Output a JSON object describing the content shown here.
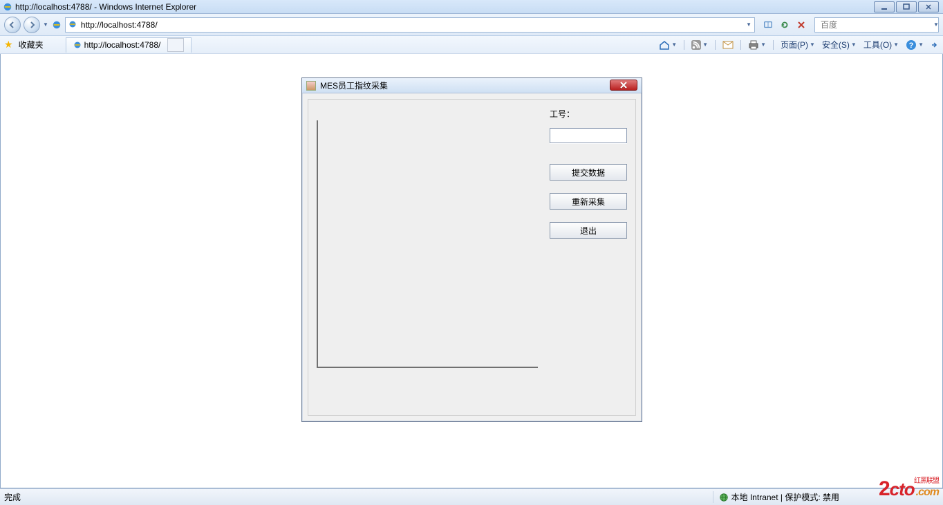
{
  "window_title": "http://localhost:4788/ - Windows Internet Explorer",
  "address_url": "http://localhost:4788/",
  "search_placeholder": "百度",
  "favorites_label": "收藏夹",
  "tab_title": "http://localhost:4788/",
  "cmdbar": {
    "page": "页面(P)",
    "safety": "安全(S)",
    "tools": "工具(O)"
  },
  "dialog": {
    "title": "MES员工指纹采集",
    "worker_id_label": "工号：",
    "worker_id_value": "",
    "submit": "提交数据",
    "recollect": "重新采集",
    "exit": "退出"
  },
  "status": {
    "done": "完成",
    "zone": "本地 Intranet | 保护模式: 禁用"
  },
  "watermark": {
    "two": "2",
    "cto": "cto",
    "com": ".com",
    "cn": "红黑联盟"
  }
}
